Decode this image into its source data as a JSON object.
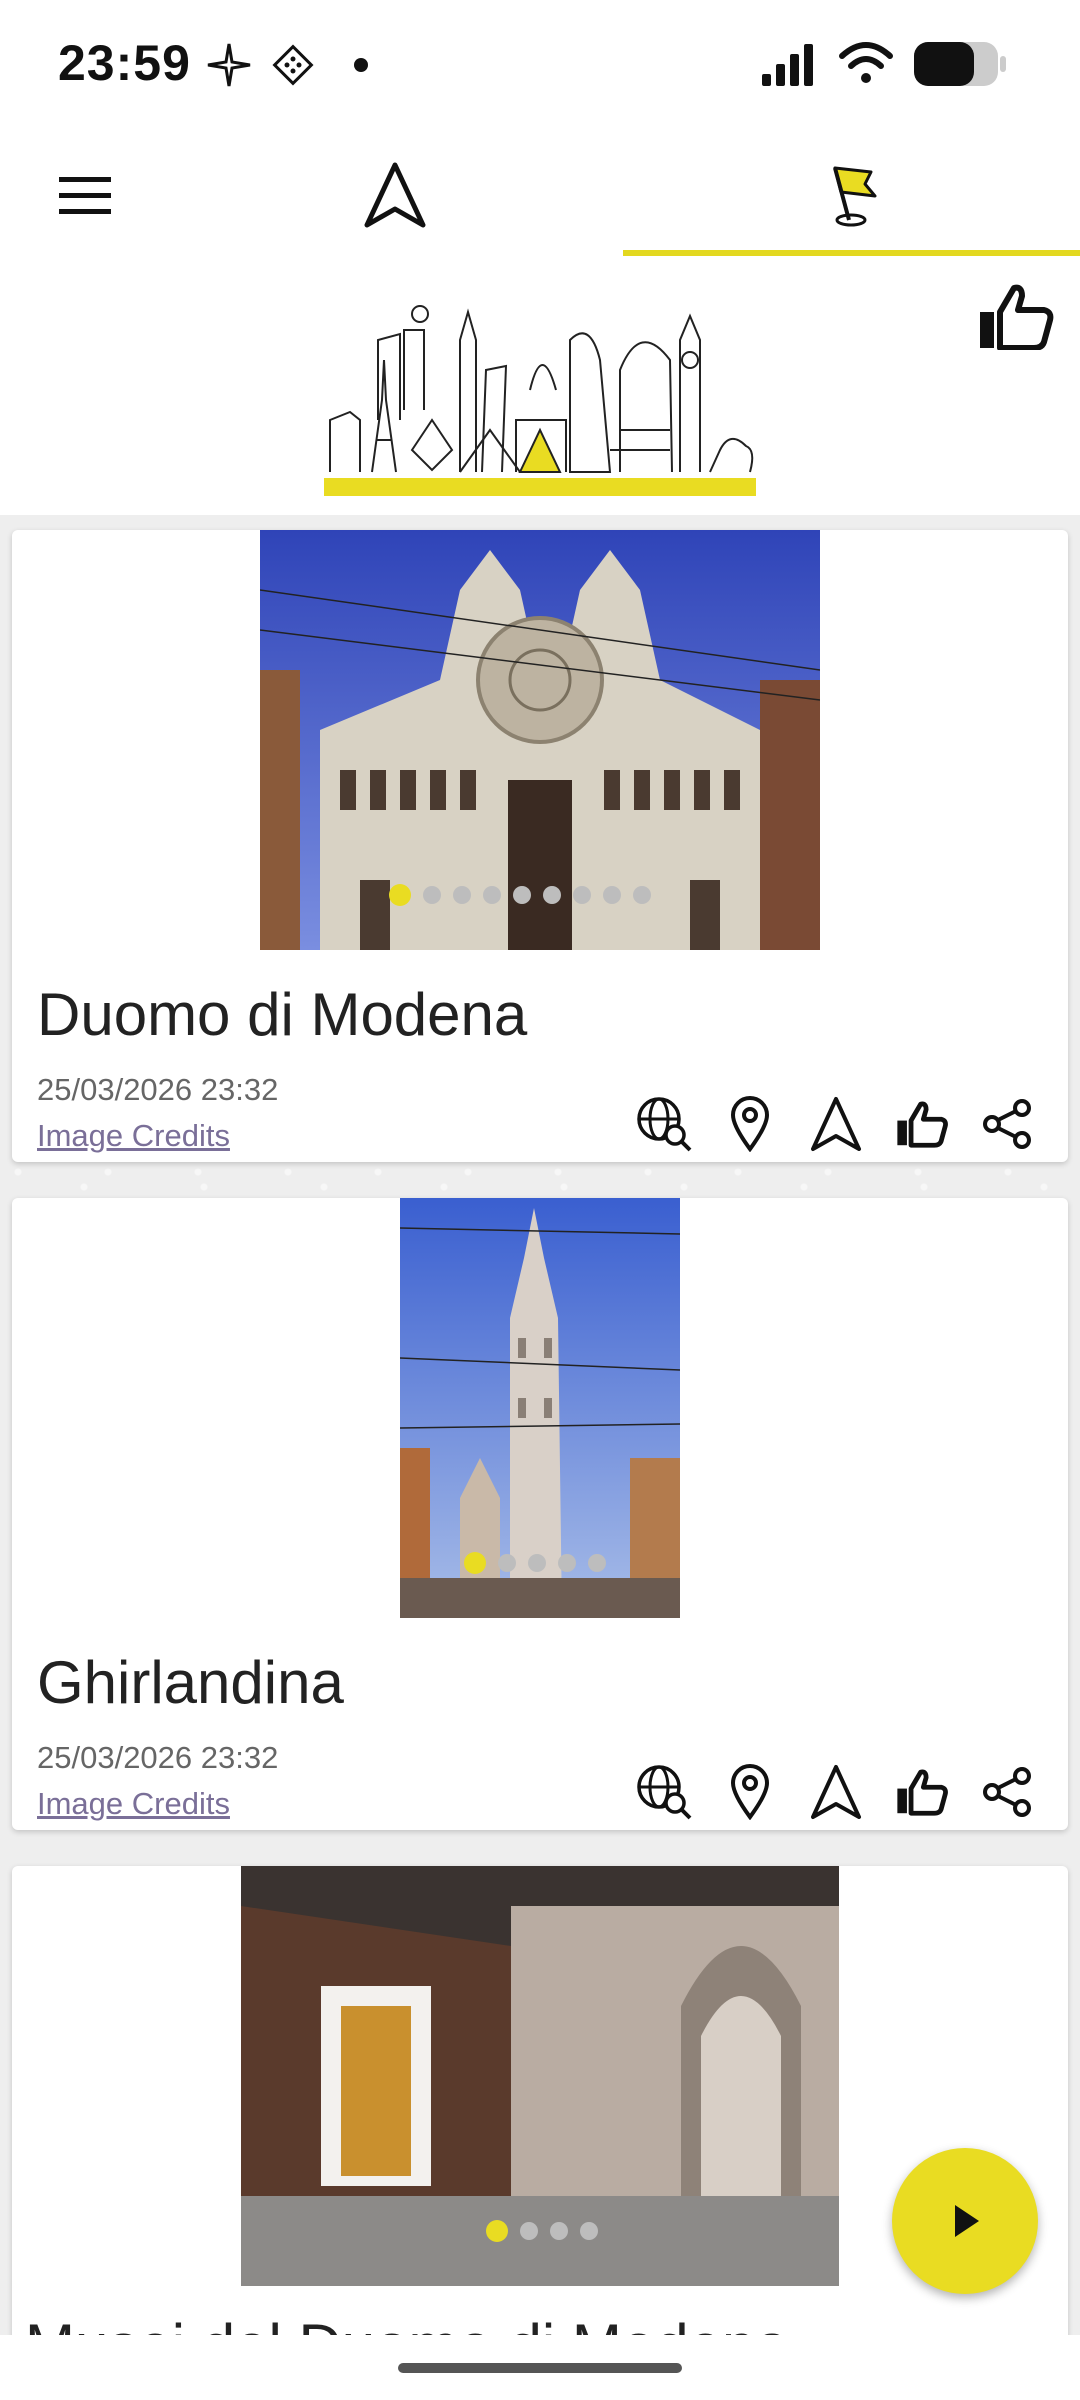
{
  "status_bar": {
    "time": "23:59"
  },
  "nav": {
    "active_tab": "tours",
    "accent": "#e3d81f"
  },
  "feed": {
    "cards": [
      {
        "title": "Duomo di Modena",
        "date": "25/03/2026 23:32",
        "credits": "Image Credits",
        "image_count": 9,
        "active_image": 1
      },
      {
        "title": "Ghirlandina",
        "date": "25/03/2026 23:32",
        "credits": "Image Credits",
        "image_count": 5,
        "active_image": 1
      },
      {
        "title": "Musei del Duomo di Modena",
        "image_count": 4,
        "active_image": 1
      }
    ]
  },
  "colors": {
    "accent": "#e9dc22",
    "credits_link": "#7a6f98"
  },
  "icons": [
    "menu-icon",
    "navigation-arrow-icon",
    "flag-pin-icon",
    "thumbs-up-icon",
    "globe-search-icon",
    "map-pin-icon",
    "share-icon",
    "play-icon"
  ]
}
